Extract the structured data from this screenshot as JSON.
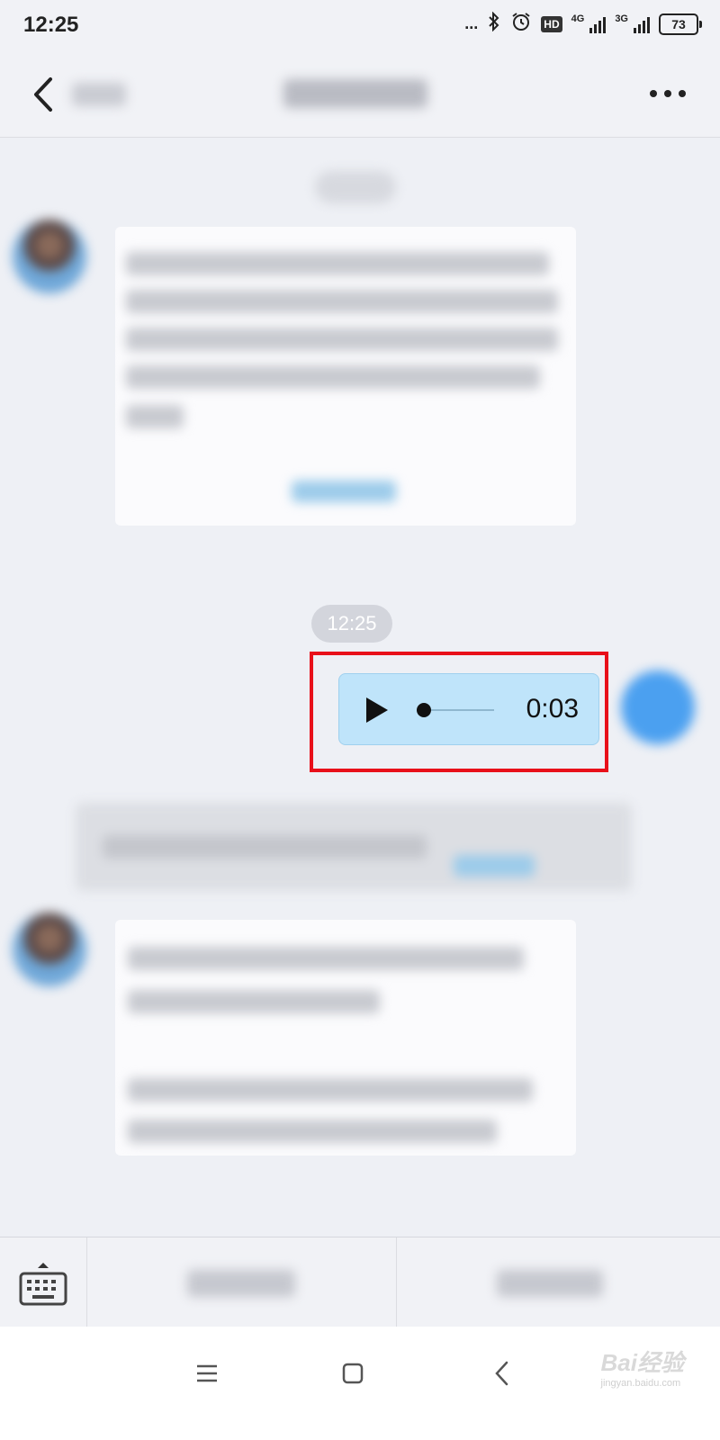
{
  "status_bar": {
    "time": "12:25",
    "dots": "...",
    "hd": "HD",
    "net1": "4G",
    "net2": "3G",
    "battery": "73"
  },
  "chat": {
    "timestamp": "12:25",
    "voice_message": {
      "duration": "0:03",
      "progress": 0
    }
  },
  "watermark": {
    "brand": "Bai经验",
    "url": "jingyan.baidu.com"
  },
  "colors": {
    "highlight_border": "#e8101a",
    "voice_bubble": "#bfe4fa",
    "self_avatar": "#4ba0f0"
  },
  "icons": [
    "back-chevron",
    "more-dots",
    "play",
    "keyboard",
    "menu",
    "home",
    "back"
  ]
}
